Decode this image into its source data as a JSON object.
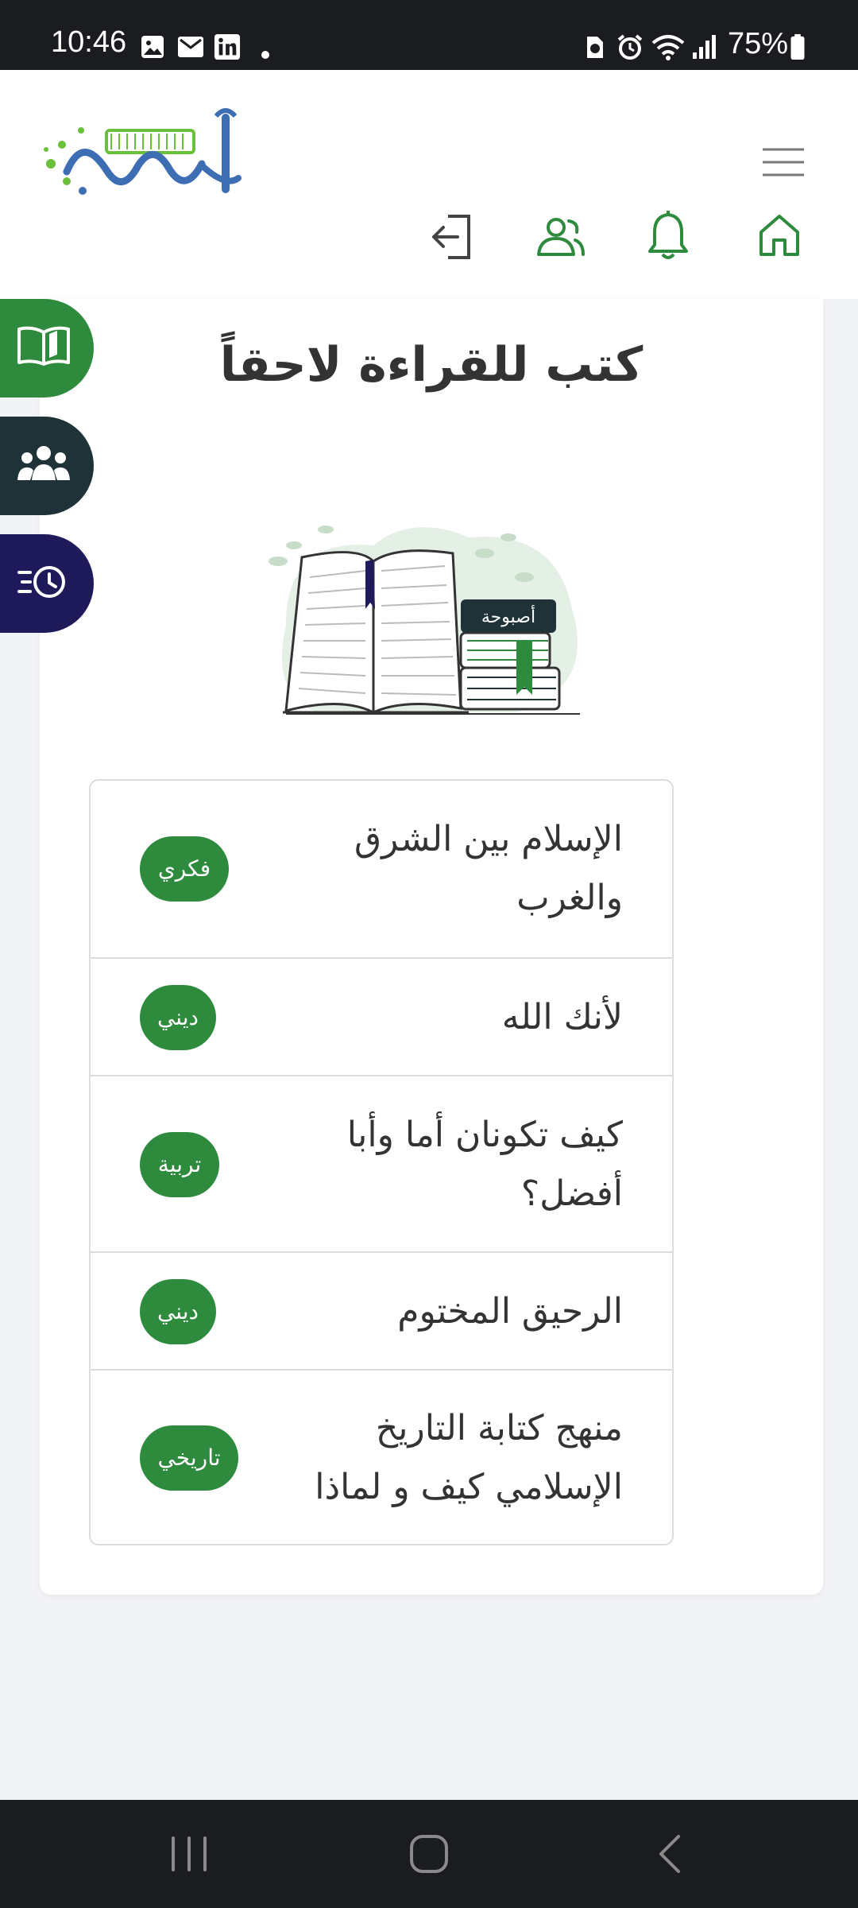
{
  "status_bar": {
    "time": "10:46",
    "battery": "75%",
    "left_icons": [
      "gallery-icon",
      "gmail-icon",
      "linkedin-icon",
      "dot-icon"
    ],
    "right_icons": [
      "sim-icon",
      "alarm-icon",
      "wifi-icon",
      "signal-icon",
      "battery-icon"
    ]
  },
  "header": {
    "logo_text": "أصبوحة",
    "icons": [
      "menu-icon",
      "logout-icon",
      "profile-icon",
      "notification-bell-icon",
      "home-icon"
    ]
  },
  "side_tabs": [
    {
      "icon": "open-book-icon",
      "color": "#2e8b3d"
    },
    {
      "icon": "group-icon",
      "color": "#1e3238"
    },
    {
      "icon": "history-list-icon",
      "color": "#1f1b5a"
    }
  ],
  "page": {
    "title": "كتب للقراءة لاحقاً",
    "hero_logo_text": "أصبوحة"
  },
  "books": [
    {
      "title_line1": "الإسلام بين الشرق",
      "title_line2": "والغرب",
      "tag": "فكري"
    },
    {
      "title_line1": "لأنك الله",
      "title_line2": "",
      "tag": "ديني"
    },
    {
      "title_line1": "كيف تكونان أما وأبا",
      "title_line2": "أفضل؟",
      "tag": "تربية"
    },
    {
      "title_line1": "الرحيق المختوم",
      "title_line2": "",
      "tag": "ديني"
    },
    {
      "title_line1": "منهج كتابة التاريخ",
      "title_line2": "الإسلامي كيف و لماذا",
      "tag": "تاريخي"
    }
  ],
  "colors": {
    "accent_green": "#2e8b3d",
    "dark_teal": "#1e3238",
    "navy": "#1f1b5a"
  },
  "nav_bar": {
    "buttons": [
      "recent-apps-icon",
      "home-button-icon",
      "back-icon"
    ]
  }
}
